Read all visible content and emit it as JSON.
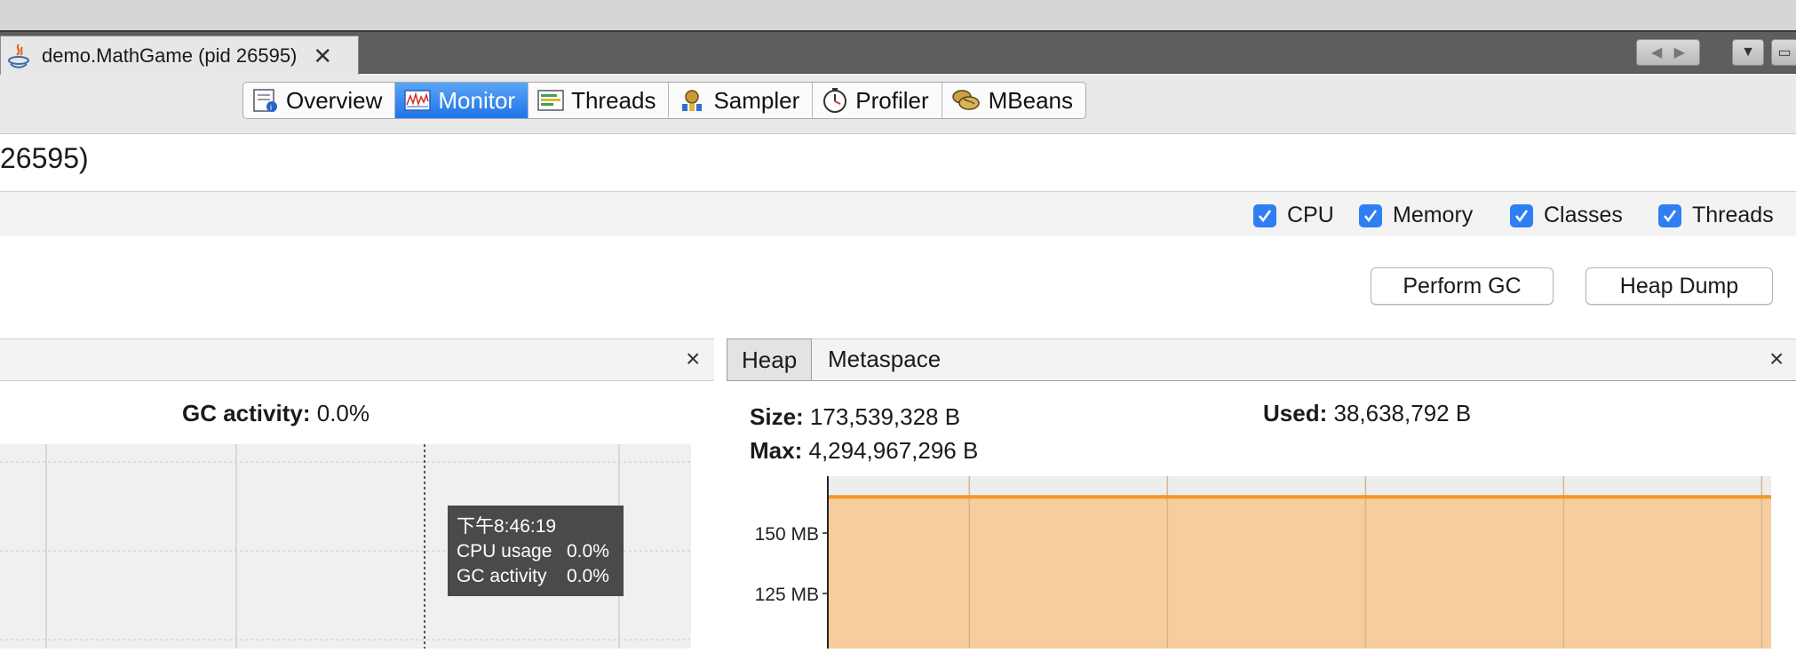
{
  "document_tab": {
    "title": "demo.MathGame (pid 26595)",
    "close": "✕"
  },
  "subtabs": [
    {
      "label": "Overview",
      "icon": "overview-icon"
    },
    {
      "label": "Monitor",
      "icon": "monitor-icon",
      "active": true
    },
    {
      "label": "Threads",
      "icon": "threads-icon"
    },
    {
      "label": "Sampler",
      "icon": "sampler-icon"
    },
    {
      "label": "Profiler",
      "icon": "profiler-icon"
    },
    {
      "label": "MBeans",
      "icon": "mbeans-icon"
    }
  ],
  "header": {
    "process_title": "26595)"
  },
  "checkboxes": [
    {
      "label": "CPU",
      "checked": true
    },
    {
      "label": "Memory",
      "checked": true
    },
    {
      "label": "Classes",
      "checked": true
    },
    {
      "label": "Threads",
      "checked": true
    }
  ],
  "buttons": {
    "perform_gc": "Perform GC",
    "heap_dump": "Heap Dump"
  },
  "cpu_panel": {
    "gc_label": "GC activity:",
    "gc_value": "0.0%",
    "close": "×",
    "tooltip": {
      "time": "下午8:46:19",
      "rows": [
        {
          "key": "CPU usage",
          "value": "0.0%"
        },
        {
          "key": "GC activity",
          "value": "0.0%"
        }
      ]
    }
  },
  "memory_panel": {
    "tabs": [
      "Heap",
      "Metaspace"
    ],
    "close": "×",
    "size_label": "Size:",
    "size_value": "173,539,328 B",
    "max_label": "Max:",
    "max_value": "4,294,967,296 B",
    "used_label": "Used:",
    "used_value": "38,638,792 B"
  },
  "colors": {
    "accent": "#2f7ff2",
    "heap_fill": "#f6cd9c",
    "heap_line": "#f0962a",
    "tooltip_bg": "#4a4a4a"
  },
  "chart_data": {
    "type": "area",
    "title": "",
    "ylabel": "",
    "y_ticks": [
      "150 MB",
      "125 MB"
    ],
    "y_unit": "MB",
    "series": [
      {
        "name": "Size",
        "values": [
          165,
          165,
          165,
          165,
          165,
          165
        ]
      }
    ],
    "grid": true
  }
}
